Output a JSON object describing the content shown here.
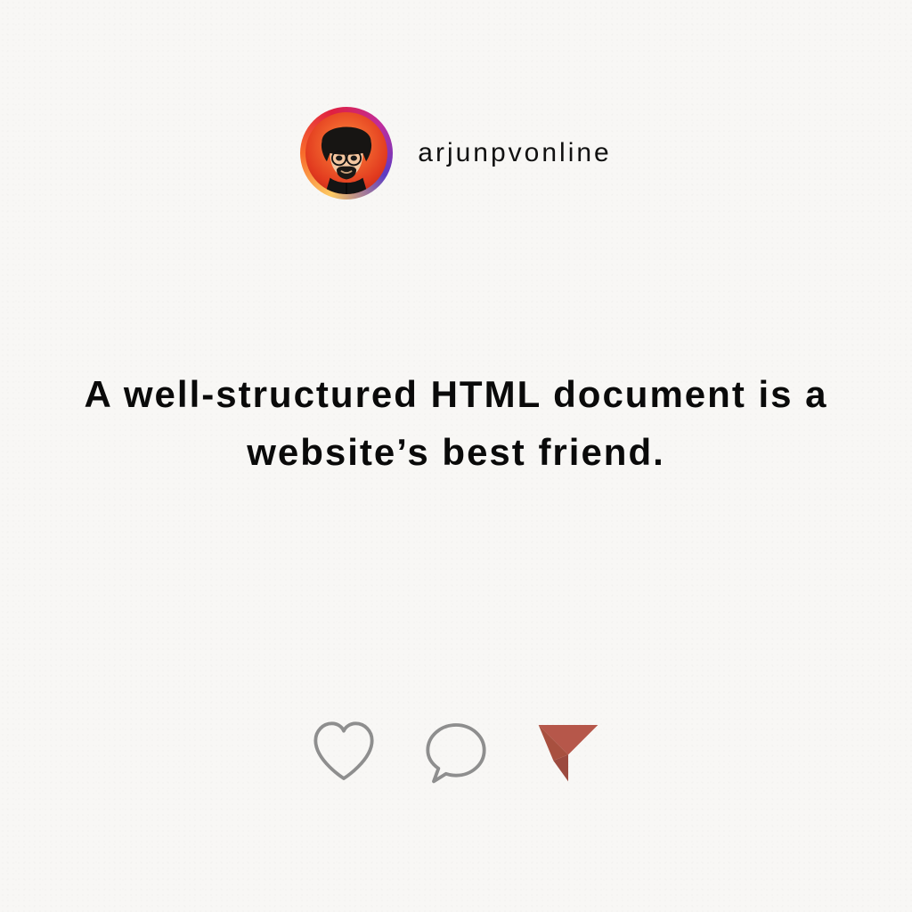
{
  "username": "arjunpvonline",
  "quote": "A well-structured HTML document is a website’s best friend.",
  "colors": {
    "share_icon": "#b6574a",
    "stroke": "#8e8e8e"
  }
}
